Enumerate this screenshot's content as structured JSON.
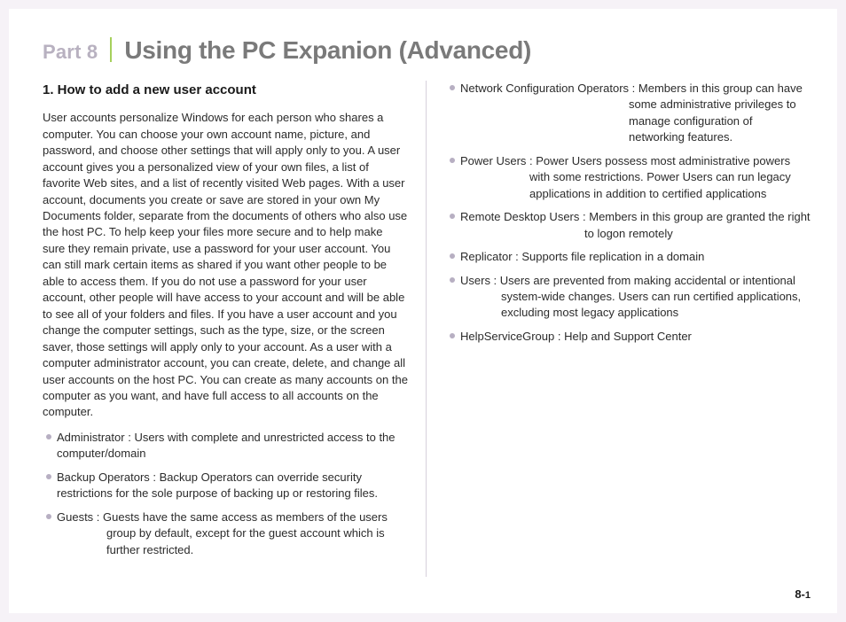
{
  "header": {
    "part": "Part 8",
    "title": "Using the PC Expanion (Advanced)"
  },
  "section": {
    "heading": "1. How to add a new user account",
    "body": "User accounts personalize Windows for each person who shares a computer. You can choose your own account name, picture, and password, and choose other settings that will apply only to you. A user account gives you a personalized view of your own files, a list of favorite Web sites, and a list of recently visited Web pages. With a user account, documents you create or save are stored in your own My Documents folder, separate from the documents of others who also use the host PC. To help keep your files more secure and to help make sure they remain private, use a password for your user account. You can still mark certain items as shared if you want other people to be able to access them. If you do not use a password for your user account, other people will have access to your account and will be able to see all of your folders and files. If you have a user account and you change the computer settings, such as the type, size, or the screen saver, those settings will apply only to your account. As a user with a computer administrator account, you can create, delete, and change all user accounts on the host PC. You can create as many accounts on the computer as you want, and have full access to all accounts on the computer."
  },
  "leftItems": [
    {
      "label": "Administrator :",
      "desc": "Users with complete and unrestricted access to the computer/domain"
    },
    {
      "label": "Backup Operators :",
      "desc": "Backup Operators can override security restrictions for the sole purpose of backing up or restoring files."
    },
    {
      "label": "Guests :",
      "desc": "Guests have the same access as members of the users group by default, except for the guest account which is further restricted."
    }
  ],
  "rightItems": [
    {
      "label": "Network Configuration Operators :",
      "desc": "Members in this group can have some administrative privileges to manage configuration of networking features."
    },
    {
      "label": "Power Users :",
      "desc": "Power Users possess most administrative powers with some restrictions. Power Users can run legacy applications in addition to certified applications"
    },
    {
      "label": "Remote Desktop Users :",
      "desc": "Members in this group are granted the right to logon remotely"
    },
    {
      "label": "Replicator :",
      "desc": "Supports file replication in a domain"
    },
    {
      "label": "Users :",
      "desc": "Users are prevented from making accidental or intentional system-wide changes. Users can run certified applications, excluding most legacy applications"
    },
    {
      "label": "HelpServiceGroup :",
      "desc": " Help and Support Center"
    }
  ],
  "pageNumber": {
    "chapter": "8-",
    "page": "1"
  }
}
